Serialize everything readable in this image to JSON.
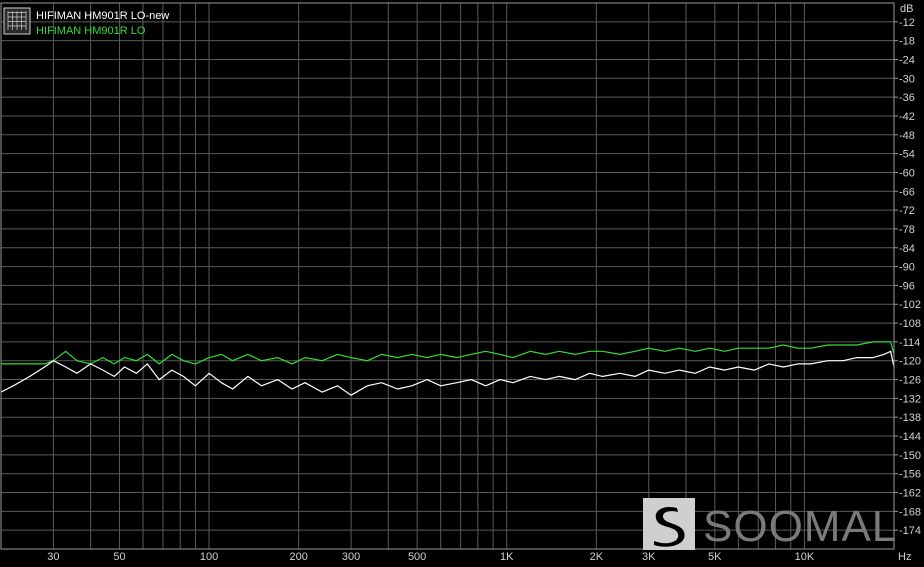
{
  "chart_data": {
    "type": "line",
    "title": "",
    "xlabel": "",
    "ylabel": "",
    "x_unit": "Hz",
    "y_unit": "dB",
    "x_scale": "log",
    "xlim": [
      20,
      20000
    ],
    "ylim": [
      -180,
      -6
    ],
    "x_ticks": [
      {
        "value": 30,
        "label": "30"
      },
      {
        "value": 50,
        "label": "50"
      },
      {
        "value": 100,
        "label": "100"
      },
      {
        "value": 200,
        "label": "200"
      },
      {
        "value": 300,
        "label": "300"
      },
      {
        "value": 500,
        "label": "500"
      },
      {
        "value": 1000,
        "label": "1K"
      },
      {
        "value": 2000,
        "label": "2K"
      },
      {
        "value": 3000,
        "label": "3K"
      },
      {
        "value": 5000,
        "label": "5K"
      },
      {
        "value": 10000,
        "label": "10K"
      }
    ],
    "y_ticks": [
      -12,
      -18,
      -24,
      -30,
      -36,
      -42,
      -48,
      -54,
      -60,
      -66,
      -72,
      -78,
      -84,
      -90,
      -96,
      -102,
      -108,
      -114,
      -120,
      -126,
      -132,
      -138,
      -144,
      -150,
      -156,
      -162,
      -168,
      -174
    ],
    "grid": true,
    "legend_position": "top-left",
    "series": [
      {
        "name": "HIFIMAN HM901R LO-new",
        "color": "#ffffff",
        "x": [
          20,
          22,
          25,
          28,
          30,
          33,
          36,
          40,
          44,
          48,
          52,
          57,
          62,
          68,
          75,
          82,
          90,
          100,
          110,
          120,
          135,
          150,
          170,
          190,
          210,
          240,
          270,
          300,
          340,
          380,
          430,
          480,
          540,
          600,
          680,
          760,
          850,
          950,
          1050,
          1200,
          1350,
          1500,
          1700,
          1900,
          2100,
          2400,
          2700,
          3000,
          3400,
          3800,
          4300,
          4800,
          5400,
          6000,
          6800,
          7600,
          8500,
          9500,
          10500,
          12000,
          13500,
          15000,
          17000,
          18500,
          19500,
          20000
        ],
        "y": [
          -130,
          -128,
          -125,
          -122,
          -120,
          -122,
          -124,
          -121,
          -123,
          -125,
          -122,
          -124,
          -121,
          -126,
          -123,
          -125,
          -128,
          -124,
          -127,
          -129,
          -125,
          -128,
          -126,
          -129,
          -127,
          -130,
          -128,
          -131,
          -128,
          -127,
          -129,
          -128,
          -126,
          -128,
          -127,
          -126,
          -128,
          -126,
          -127,
          -125,
          -126,
          -125,
          -126,
          -124,
          -125,
          -124,
          -125,
          -123,
          -124,
          -123,
          -124,
          -122,
          -123,
          -122,
          -123,
          -121,
          -122,
          -121,
          -121,
          -120,
          -120,
          -119,
          -119,
          -118,
          -117,
          -122
        ]
      },
      {
        "name": "HIFIMAN HM901R LO",
        "color": "#33dd33",
        "x": [
          20,
          22,
          25,
          28,
          30,
          33,
          36,
          40,
          44,
          48,
          52,
          57,
          62,
          68,
          75,
          82,
          90,
          100,
          110,
          120,
          135,
          150,
          170,
          190,
          210,
          240,
          270,
          300,
          340,
          380,
          430,
          480,
          540,
          600,
          680,
          760,
          850,
          950,
          1050,
          1200,
          1350,
          1500,
          1700,
          1900,
          2100,
          2400,
          2700,
          3000,
          3400,
          3800,
          4300,
          4800,
          5400,
          6000,
          6800,
          7600,
          8500,
          9500,
          10500,
          12000,
          13500,
          15000,
          17000,
          18500,
          19500,
          20000
        ],
        "y": [
          -121,
          -121,
          -121,
          -121,
          -120,
          -117,
          -120,
          -121,
          -119,
          -121,
          -119,
          -120,
          -118,
          -121,
          -118,
          -120,
          -121,
          -119,
          -118,
          -120,
          -118,
          -120,
          -119,
          -121,
          -119,
          -120,
          -118,
          -119,
          -120,
          -118,
          -119,
          -118,
          -119,
          -118,
          -119,
          -118,
          -117,
          -118,
          -119,
          -117,
          -118,
          -117,
          -118,
          -117,
          -117,
          -118,
          -117,
          -116,
          -117,
          -116,
          -117,
          -116,
          -117,
          -116,
          -116,
          -116,
          -115,
          -116,
          -116,
          -115,
          -115,
          -115,
          -114,
          -114,
          -114,
          -118
        ]
      }
    ],
    "watermark": "SOOMAL"
  }
}
